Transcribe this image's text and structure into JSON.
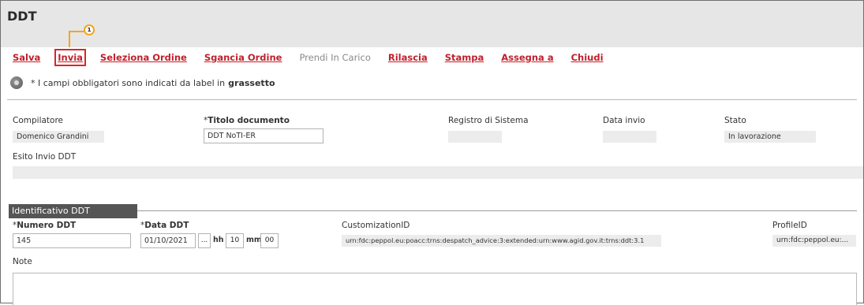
{
  "header": {
    "title": "DDT"
  },
  "callout": {
    "number": "1"
  },
  "toolbar": {
    "items": [
      {
        "label": "Salva",
        "enabled": true
      },
      {
        "label": "Invia",
        "enabled": true,
        "highlighted": true
      },
      {
        "label": "Seleziona Ordine",
        "enabled": true
      },
      {
        "label": "Sgancia Ordine",
        "enabled": true
      },
      {
        "label": "Prendi In Carico",
        "enabled": false
      },
      {
        "label": "Rilascia",
        "enabled": true
      },
      {
        "label": "Stampa",
        "enabled": true
      },
      {
        "label": "Assegna a",
        "enabled": true
      },
      {
        "label": "Chiudi",
        "enabled": true
      }
    ]
  },
  "info": {
    "text": "* I campi obbligatori sono indicati da label in",
    "bold": "grassetto",
    "icon": "info-icon"
  },
  "fields": {
    "compilatore": {
      "label": "Compilatore",
      "value": "Domenico Grandini"
    },
    "titolo": {
      "prefix": "*",
      "label": "Titolo documento",
      "value": "DDT NoTI-ER"
    },
    "registro": {
      "label": "Registro di Sistema",
      "value": ""
    },
    "data_invio": {
      "label": "Data invio",
      "value": ""
    },
    "stato": {
      "label": "Stato",
      "value": "In lavorazione"
    },
    "esito": {
      "label": "Esito Invio DDT",
      "value": ""
    }
  },
  "section": {
    "title": "Identificativo DDT",
    "numero": {
      "prefix": "*",
      "label": "Numero DDT",
      "value": "145"
    },
    "data": {
      "prefix": "*",
      "label": "Data DDT",
      "date": "01/10/2021",
      "picker": "...",
      "hh_label": "hh",
      "hh": "10",
      "mm_label": "mm",
      "mm": "00"
    },
    "customization": {
      "label": "CustomizationID",
      "value": "urn:fdc:peppol.eu:poacc:trns:despatch_advice:3:extended:urn:www.agid.gov.it:trns:ddt:3.1"
    },
    "profile": {
      "label": "ProfileID",
      "value": "urn:fdc:peppol.eu:..."
    },
    "note": {
      "label": "Note",
      "value": ""
    }
  }
}
